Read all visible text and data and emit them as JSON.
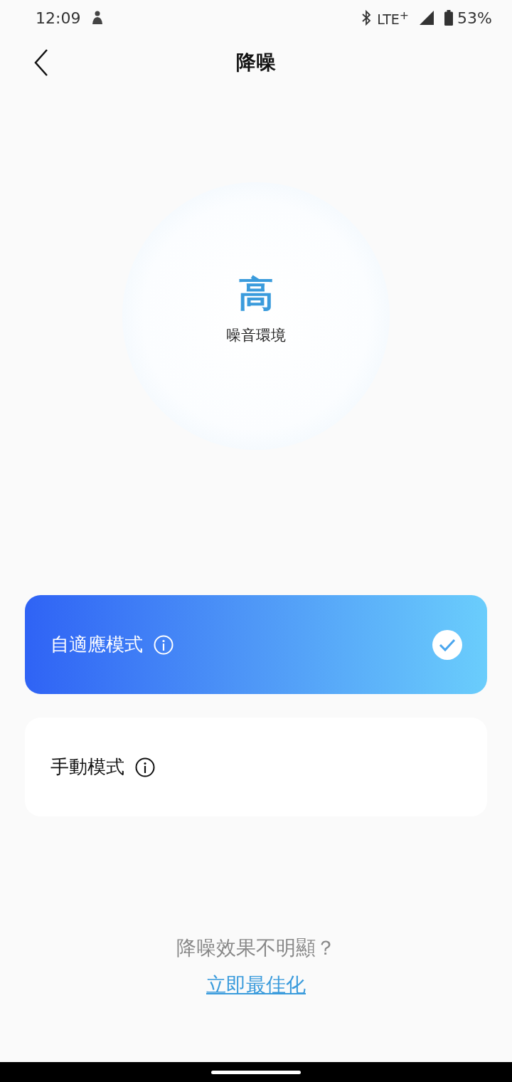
{
  "status_bar": {
    "time": "12:09",
    "network": "LTE$^{+}$",
    "battery": "53%"
  },
  "header": {
    "title": "降噪"
  },
  "level_display": {
    "value": "高",
    "caption": "噪音環境"
  },
  "modes": [
    {
      "label": "自適應模式",
      "selected": true
    },
    {
      "label": "手動模式",
      "selected": false
    }
  ],
  "footer": {
    "question": "降噪效果不明顯？",
    "link": "立即最佳化"
  }
}
